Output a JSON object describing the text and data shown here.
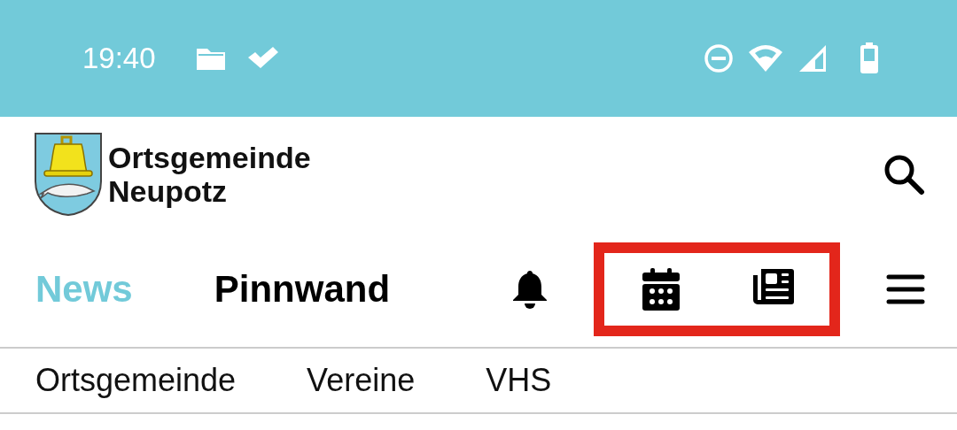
{
  "status_bar": {
    "time": "19:40"
  },
  "header": {
    "title_line1": "Ortsgemeinde",
    "title_line2": "Neupotz"
  },
  "main_tabs": [
    {
      "label": "News",
      "selected": true
    },
    {
      "label": "Pinnwand",
      "selected": false
    }
  ],
  "nav_icons": [
    {
      "kind": "bell",
      "highlighted": false
    },
    {
      "kind": "calendar",
      "highlighted": true
    },
    {
      "kind": "newspaper",
      "highlighted": true
    }
  ],
  "sub_tabs": [
    {
      "label": "Ortsgemeinde"
    },
    {
      "label": "Vereine"
    },
    {
      "label": "VHS"
    }
  ]
}
